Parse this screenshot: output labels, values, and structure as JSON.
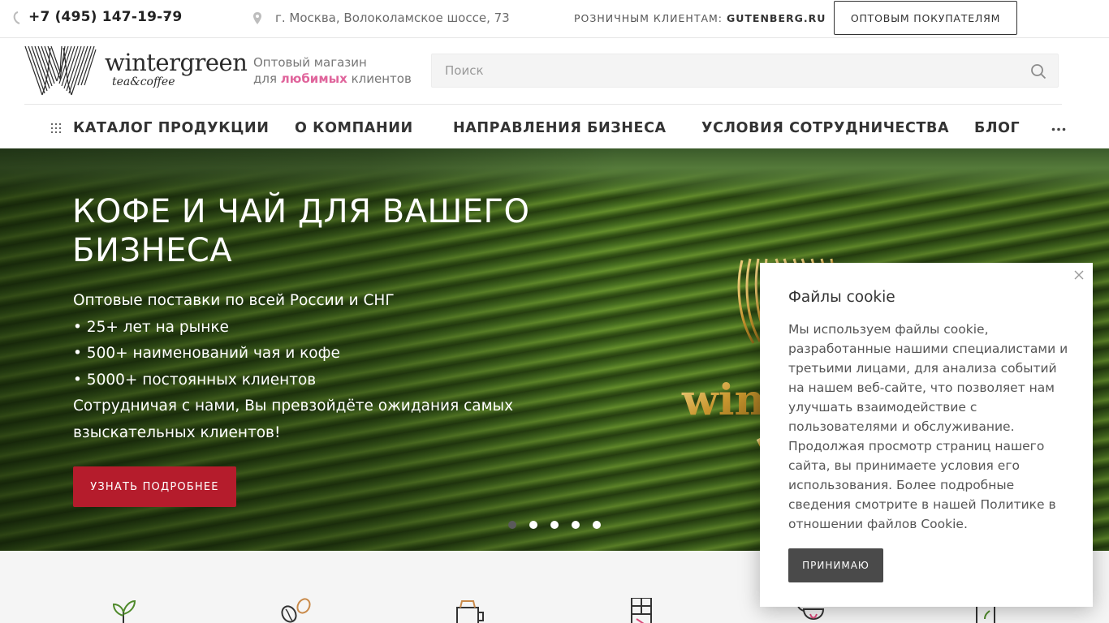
{
  "topbar": {
    "phone": "+7 (495) 147-19-79",
    "address": "г. Москва, Волоколамское шоссе, 73",
    "retail_label": "РОЗНИЧНЫМ КЛИЕНТАМ:",
    "retail_link": "GUTENBERG.RU",
    "wholesale_button": "ОПТОВЫМ ПОКУПАТЕЛЯМ"
  },
  "header": {
    "logo_name": "wintergreen",
    "logo_sub": "tea&coffee",
    "tagline_line1": "Оптовый магазин",
    "tagline_pre": "для",
    "tagline_accent": "любимых",
    "tagline_post": "клиентов",
    "search_placeholder": "Поиск",
    "accent_color": "#e0659c"
  },
  "nav": {
    "items": [
      {
        "label": "КАТАЛОГ ПРОДУКЦИИ"
      },
      {
        "label": "О КОМПАНИИ"
      },
      {
        "label": "НАПРАВЛЕНИЯ БИЗНЕСА"
      },
      {
        "label": "УСЛОВИЯ СОТРУДНИЧЕСТВА"
      },
      {
        "label": "БЛОГ"
      }
    ]
  },
  "hero": {
    "title": "КОФЕ И ЧАЙ ДЛЯ ВАШЕГО БИЗНЕСА",
    "lines": [
      "Оптовые поставки по всей России и СНГ",
      "• 25+ лет на рынке",
      "• 500+ наименований чая и кофе",
      "• 5000+ постоянных клиентов",
      "Сотрудничая с нами, Вы превзойдёте ожидания самых взыскательных клиентов!"
    ],
    "button": "УЗНАТЬ ПОДРОБНЕЕ",
    "button_color": "#b51c2c",
    "slides_total": 5,
    "slide_active": 1
  },
  "features": {
    "icons": [
      "tea-leaf-icon",
      "coffee-beans-icon",
      "coffee-grinder-icon",
      "chocolate-bar-icon",
      "teapot-icon",
      "bottle-icon"
    ]
  },
  "cookie": {
    "title": "Файлы cookie",
    "text": "Мы используем файлы cookie, разработанные нашими специалистами и третьими лицами, для анализа событий на нашем веб-сайте, что позволяет нам улучшать взаимодействие с пользователями и обслуживание. Продолжая просмотр страниц нашего сайта, вы принимаете условия его использования. Более подробные сведения смотрите в нашей Политике в отношении файлов Cookie.",
    "accept_button": "ПРИНИМАЮ"
  }
}
